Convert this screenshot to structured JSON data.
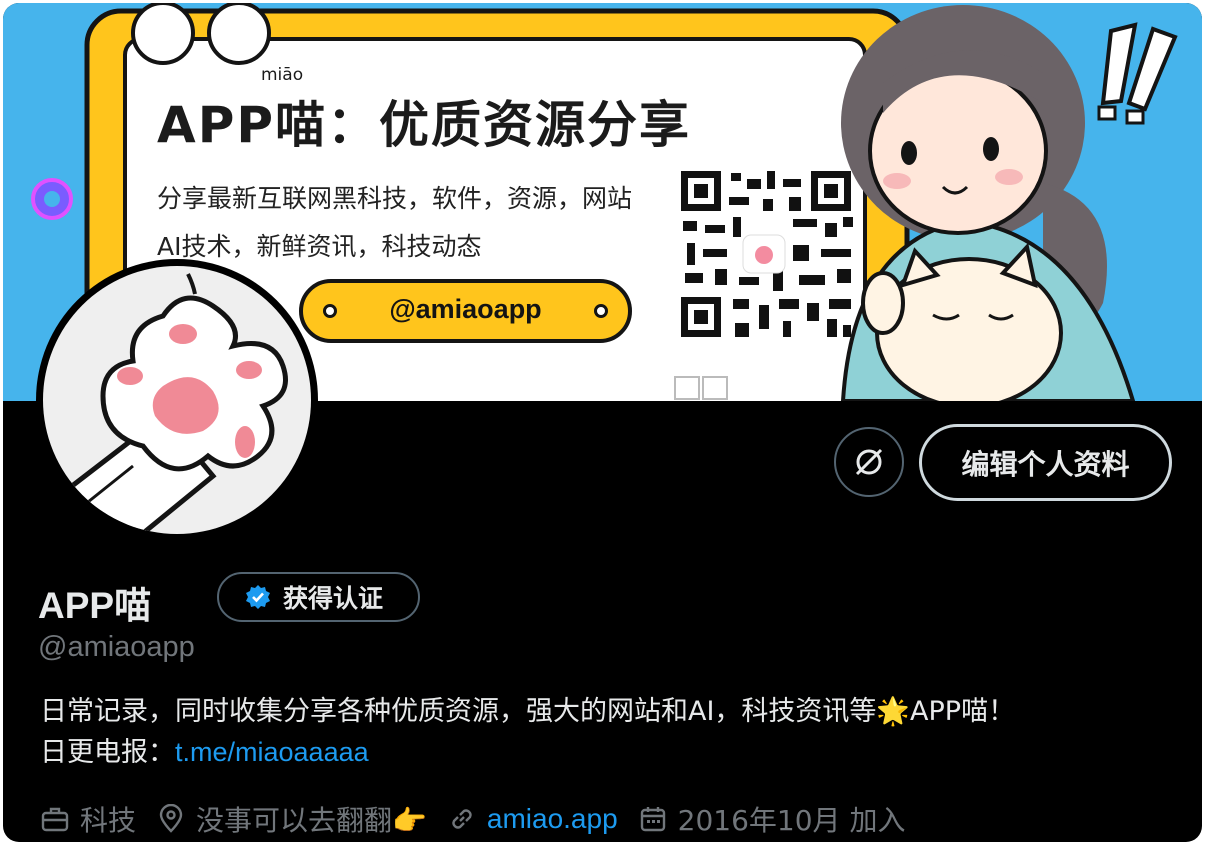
{
  "banner": {
    "title": "APP喵：优质资源分享",
    "pinyin": "miāo",
    "line1": "分享最新互联网黑科技，软件，资源，网站",
    "line2": "AI技术，新鲜资讯，科技动态",
    "handle": "@amiaoapp"
  },
  "actions": {
    "edit_label": "编辑个人资料",
    "icon_name": "grok-icon"
  },
  "profile": {
    "name": "APP喵",
    "verify_label": "获得认证",
    "handle": "@amiaoapp",
    "bio_line1": "日常记录，同时收集分享各种优质资源，强大的网站和AI，科技资讯等🌟APP喵！",
    "bio_line2_prefix": "日更电报：",
    "bio_link": "t.me/miaoaaaaa"
  },
  "meta": {
    "category": "科技",
    "location": "没事可以去翻翻👉",
    "website": "amiao.app",
    "joined": "2016年10月 加入"
  },
  "colors": {
    "background": "#000000",
    "text": "#e7e9ea",
    "muted": "#71767b",
    "link": "#1d9bf0",
    "border": "#536471",
    "banner_sky": "#46b4ec",
    "banner_frame": "#ffc51c"
  }
}
